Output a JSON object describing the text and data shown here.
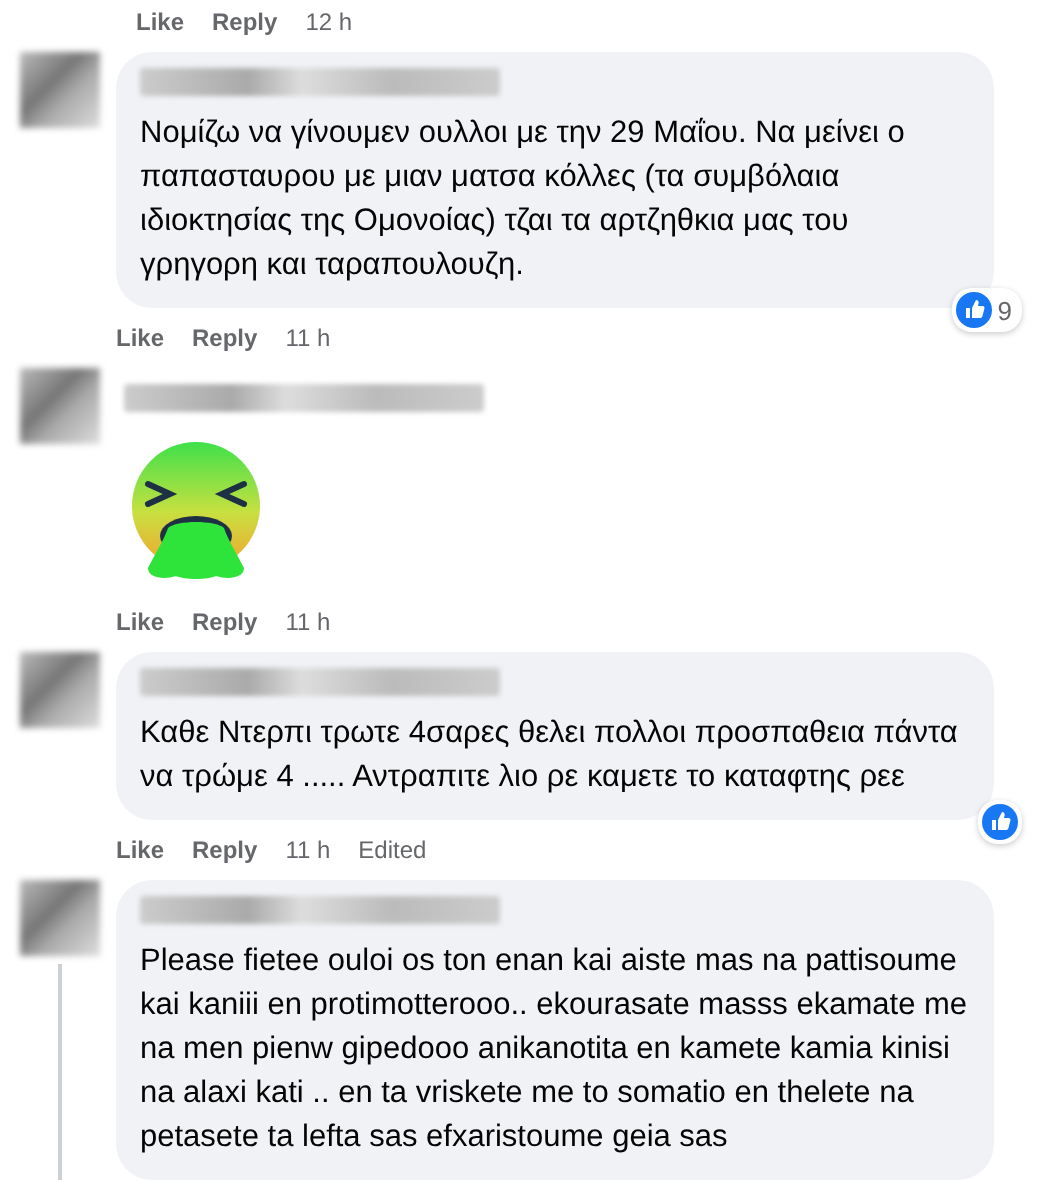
{
  "top_actions": {
    "actions": [
      "Like",
      "Reply"
    ],
    "time": "12 h"
  },
  "comments": [
    {
      "kind": "text",
      "text": "Νομίζω να γίνουμεν ουλλοι με την 29 Μαΐου. Να μείνει ο παπασταυρου με μιαν ματσα κόλλες (τα συμβόλαια ιδιοκτησίας της Ομονοίας) τζαι τα αρτζηθκια μας του γρηγορη και ταραπουλουζη.",
      "reacted": true,
      "reaction_count": "9",
      "actions": [
        "Like",
        "Reply"
      ],
      "time": "11 h",
      "has_replies": false
    },
    {
      "kind": "sticker",
      "actions": [
        "Like",
        "Reply"
      ],
      "time": "11 h",
      "has_replies": false
    },
    {
      "kind": "text",
      "text": "Καθε Ντερπι τρωτε 4σαρες θελει πολλοι προσπαθεια πάντα να τρώμε 4 ..... Αντραπιτε λιο ρε καμετε το καταφτης ρεε",
      "reacted": true,
      "actions": [
        "Like",
        "Reply"
      ],
      "time": "11 h",
      "edited": "Edited",
      "has_replies": false
    },
    {
      "kind": "text",
      "text": "Please fietee ouloi os ton enan kai aiste mas na pattisoume kai kaniii en protimotterooo.. ekourasate masss ekamate me na men pienw gipedooo anikanotita en kamete kamia kinisi na alaxi kati .. en ta vriskete me to somatio en thelete na petasete ta lefta sas efxaristoume geia sas",
      "reacted": false,
      "has_replies": true
    }
  ]
}
